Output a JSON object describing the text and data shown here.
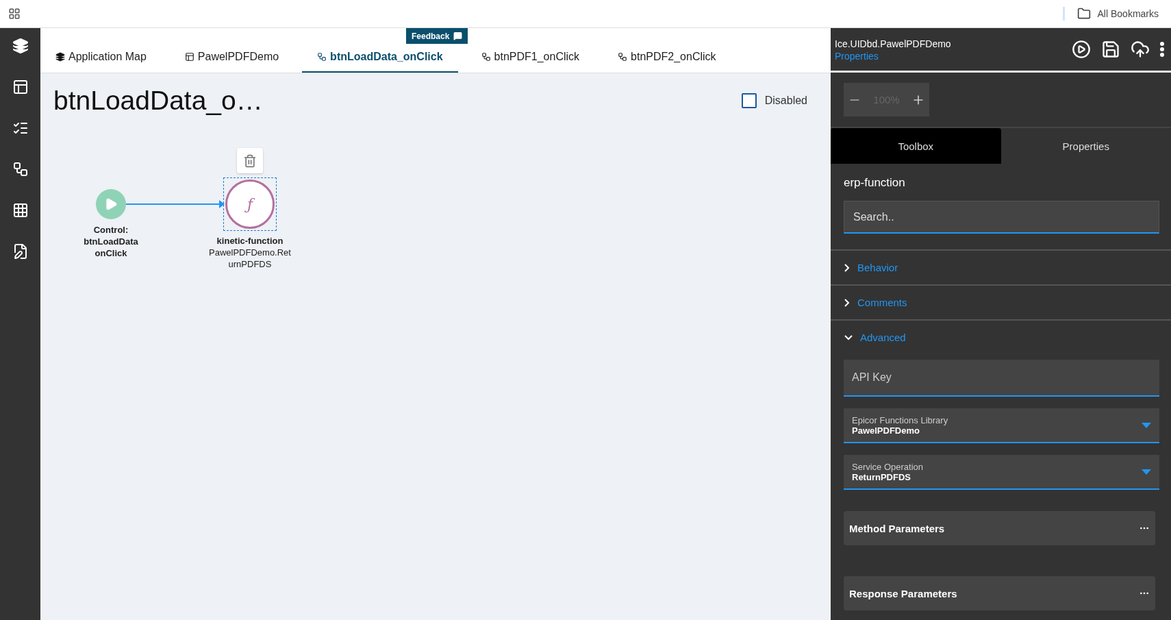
{
  "browser_bar": {
    "bookmarks_label": "All Bookmarks"
  },
  "feedback": {
    "label": "Feedback"
  },
  "tabs": [
    {
      "label": "Application Map",
      "kind": "map",
      "selected": false
    },
    {
      "label": "PawelPDFDemo",
      "kind": "page",
      "selected": false
    },
    {
      "label": "btnLoadData_onClick",
      "kind": "event",
      "selected": true
    },
    {
      "label": "btnPDF1_onClick",
      "kind": "event",
      "selected": false
    },
    {
      "label": "btnPDF2_onClick",
      "kind": "event",
      "selected": false
    }
  ],
  "canvas": {
    "title": "btnLoadData_o…",
    "disabled": {
      "label": "Disabled",
      "checked": false
    },
    "nodes": [
      {
        "kind": "start",
        "selected": false,
        "title": "Control: btnLoadData onClick"
      },
      {
        "kind": "function",
        "selected": true,
        "symbol": "ƒ",
        "title": "kinetic-function",
        "subtitle": "PawelPDFDemo.ReturnPDFDS"
      }
    ]
  },
  "panel": {
    "title": "Ice.UIDbd.PawelPDFDemo",
    "subtitle": "Properties",
    "zoom": "100%",
    "tabs": [
      {
        "label": "Toolbox",
        "selected": true
      },
      {
        "label": "Properties",
        "selected": false
      }
    ],
    "heading": "erp-function",
    "search": {
      "placeholder": "Search.."
    },
    "sections": [
      {
        "label": "Behavior",
        "expanded": false
      },
      {
        "label": "Comments",
        "expanded": false
      },
      {
        "label": "Advanced",
        "expanded": true,
        "fields": [
          {
            "kind": "input",
            "placeholder": "API Key"
          },
          {
            "kind": "select",
            "label": "Epicor Functions Library",
            "value": "PawelPDFDemo"
          },
          {
            "kind": "select",
            "label": "Service Operation",
            "value": "ReturnPDFDS"
          },
          {
            "kind": "button",
            "label": "Method Parameters"
          },
          {
            "kind": "button",
            "label": "Response Parameters"
          }
        ]
      }
    ]
  }
}
